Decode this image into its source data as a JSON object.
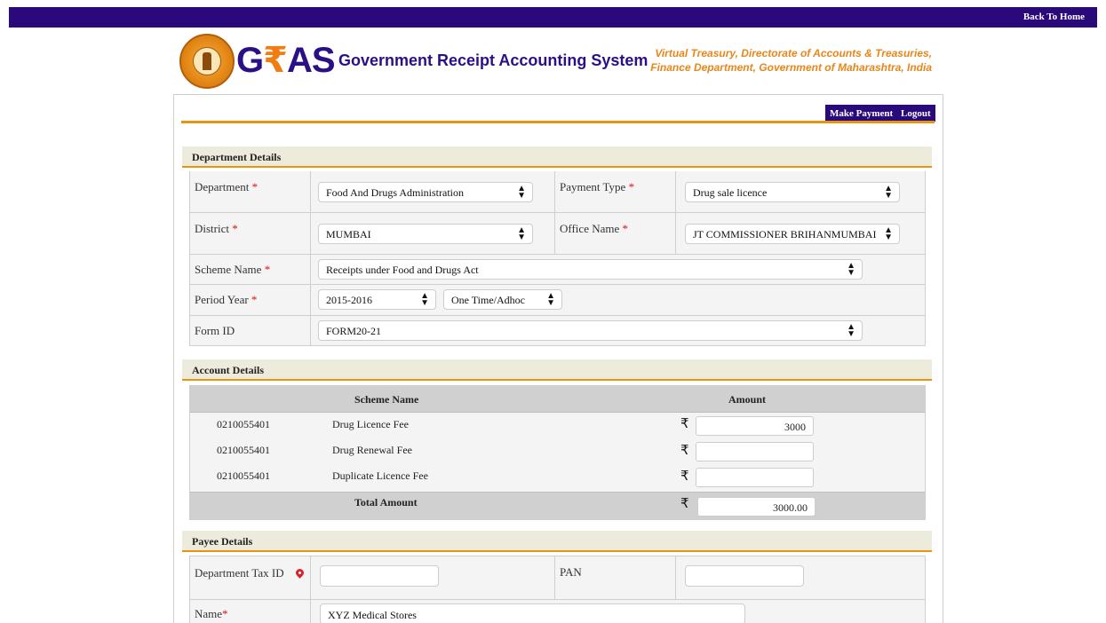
{
  "topbar": {
    "back_to_home": "Back To Home"
  },
  "brand": {
    "logo_text_g": "G",
    "logo_text_rupee": "₹",
    "logo_text_as": "AS",
    "subtitle": "Government Receipt Accounting System",
    "org_line1": "Virtual Treasury, Directorate of Accounts & Treasuries,",
    "org_line2": "Finance Department, Government of Maharashtra, India"
  },
  "actions": {
    "make_payment": "Make Payment",
    "logout": "Logout"
  },
  "department": {
    "heading": "Department Details",
    "department_label": "Department",
    "department_value": "Food And Drugs Administration",
    "payment_type_label": "Payment Type",
    "payment_type_value": "Drug sale licence",
    "district_label": "District",
    "district_value": "MUMBAI",
    "office_label": "Office Name",
    "office_value": "JT COMMISSIONER BRIHANMUMBAI",
    "scheme_label": "Scheme Name",
    "scheme_value": "Receipts under Food and Drugs Act",
    "period_label": "Period Year",
    "period_year_value": "2015-2016",
    "period_type_value": "One Time/Adhoc",
    "form_label": "Form ID",
    "form_value": "FORM20-21",
    "required_mark": "*",
    "arrow": "▲▼"
  },
  "account": {
    "heading": "Account Details",
    "col_scheme": "Scheme Name",
    "col_amount": "Amount",
    "rupee": "₹",
    "rows": [
      {
        "code": "0210055401",
        "name": "Drug Licence Fee",
        "amount": "3000"
      },
      {
        "code": "0210055401",
        "name": "Drug Renewal Fee",
        "amount": ""
      },
      {
        "code": "0210055401",
        "name": "Duplicate Licence Fee",
        "amount": ""
      }
    ],
    "total_label": "Total Amount",
    "total_value": "3000.00"
  },
  "payee": {
    "heading": "Payee Details",
    "tax_id_label": "Department Tax ID",
    "tax_id_value": "",
    "pan_label": "PAN",
    "pan_value": "",
    "name_label": "Name",
    "name_value": "XYZ Medical Stores",
    "required_mark": "*"
  },
  "colors": {
    "brand_navy": "#2a0a7a",
    "accent_orange": "#e8940f",
    "required_red": "#dd1111"
  }
}
